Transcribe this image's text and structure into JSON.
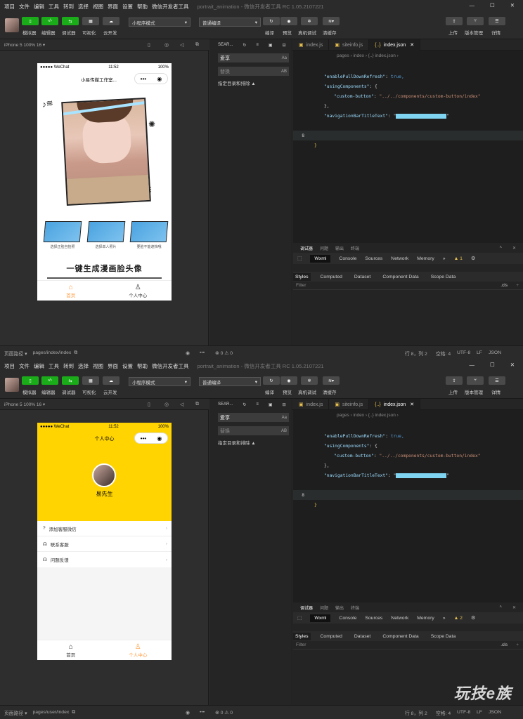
{
  "menu": [
    "项目",
    "文件",
    "编辑",
    "工具",
    "转到",
    "选择",
    "视图",
    "界面",
    "设置",
    "帮助",
    "微信开发者工具"
  ],
  "window_title": "portrait_animation - 微信开发者工具 RC 1.05.2107221",
  "toolbar": {
    "simulator": "模拟器",
    "editor": "编辑器",
    "debugger": "调试器",
    "visual": "可视化",
    "cloud": "云开发",
    "mode": "小程序模式",
    "compile_mode": "普通编译",
    "compile": "编译",
    "preview": "预览",
    "real_debug": "真机调试",
    "clear_cache": "清缓存",
    "upload": "上传",
    "version": "版本管理",
    "details": "详情"
  },
  "device": "iPhone 5 100% 16 ▾",
  "explorer": {
    "search_label": "SEAR...",
    "search_value": "爱享",
    "replace_placeholder": "替换",
    "filter_text": "指定目录和排除 ▲",
    "aa": "Aa",
    "ab": "AB"
  },
  "editor": {
    "tabs": [
      "index.js",
      "siteinfo.js",
      "index.json"
    ],
    "breadcrumb": "pages › index › {..} index.json ›",
    "lines": {
      "l2_key": "\"enablePullDownRefresh\"",
      "l2_val": "true,",
      "l3_key": "\"usingComponents\"",
      "l3_val": "{",
      "l4_key": "\"custom-button\"",
      "l4_val": "\"../../components/custom-button/index\"",
      "l5": "},",
      "l6_key": "\"navigationBarTitleText\"",
      "l8": "8",
      "l9": "}"
    }
  },
  "devtools": {
    "top_tabs": [
      "调试器",
      "问题",
      "输出",
      "终端"
    ],
    "panels": [
      "Wxml",
      "Console",
      "Sources",
      "Network",
      "Memory"
    ],
    "sub_panels": [
      "Styles",
      "Computed",
      "Dataset",
      "Component Data",
      "Scope Data"
    ],
    "filter": "Filter",
    "cls": ".cls",
    "warn_top": "▲ 1",
    "warn_bottom": "▲ 2"
  },
  "status": {
    "path_label": "页面路径 ▾",
    "top_path": "pages/index/index",
    "bottom_path": "pages/user/index",
    "errors": "⊗ 0 ⚠ 0",
    "cursor": "行 8，列 2",
    "spaces": "空格: 4",
    "encoding": "UTF-8",
    "eol": "LF",
    "lang": "JSON"
  },
  "phone_top": {
    "time": "11:52",
    "carrier": "●●●●● WeChat",
    "battery": "100%",
    "title": "小易传媒工作室...",
    "opt1": "选择正脸自拍照",
    "opt2": "选择单人照片",
    "opt3": "要脸不能遮挡哦",
    "headline": "一键生成漫画脸头像",
    "tab_home": "首页",
    "tab_me": "个人中心"
  },
  "phone_bottom": {
    "time": "11:52",
    "carrier": "●●●●● WeChat",
    "battery": "100%",
    "title": "个人中心",
    "user": "易先生",
    "item1": "添加客服微信",
    "item2": "联系客服",
    "item3": "问题反馈",
    "tab_home": "首页",
    "tab_me": "个人中心"
  },
  "watermark": "玩技e族",
  "colors": {
    "accent_green": "#1aad19",
    "yellow": "#ffd400",
    "tab_orange": "#ff9a3c"
  }
}
